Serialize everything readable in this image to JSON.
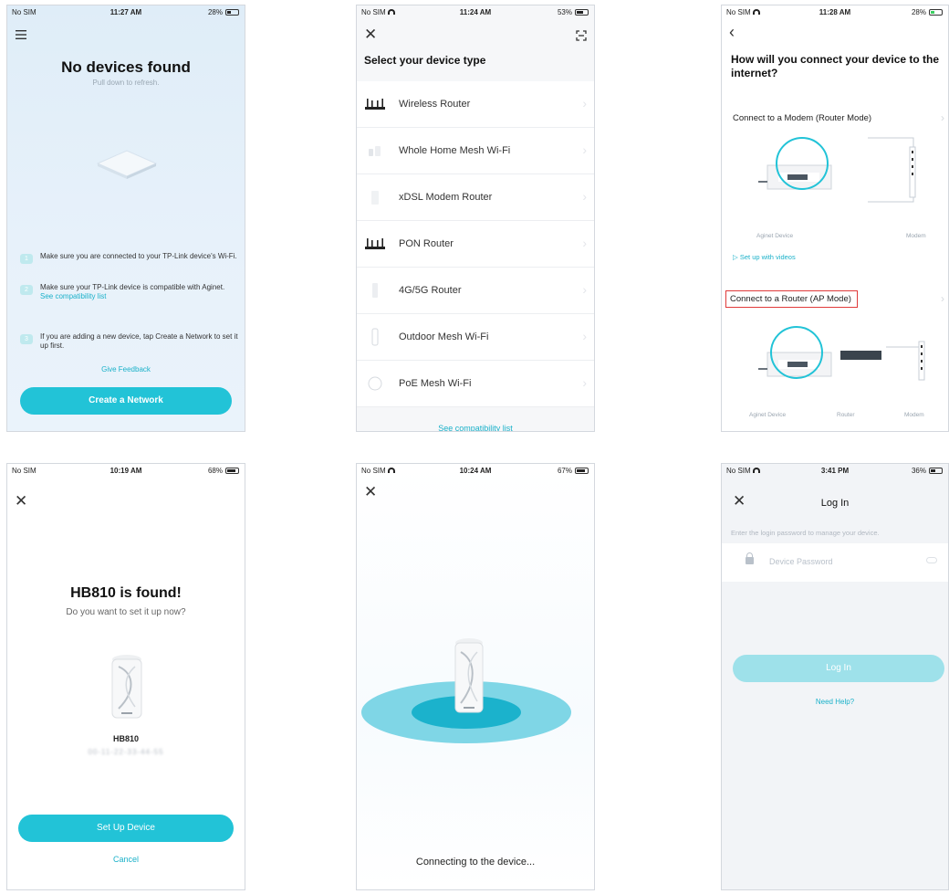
{
  "screens": {
    "no_devices": {
      "status": {
        "carrier": "No SIM",
        "time": "11:27 AM",
        "battery": "28%"
      },
      "menu_icon": "hamburger-menu-icon",
      "title": "No devices found",
      "subtitle": "Pull down to refresh.",
      "tips": [
        {
          "num": "1",
          "text": "Make sure you are connected to your TP-Link device's Wi-Fi.",
          "link": ""
        },
        {
          "num": "2",
          "text": "Make sure your TP-Link device is compatible with Aginet.",
          "link": "See compatibility list"
        },
        {
          "num": "3",
          "text": "If you are adding a new device, tap Create a Network to set it up first.",
          "link": ""
        }
      ],
      "feedback": "Give Feedback",
      "cta": "Create a Network"
    },
    "device_type": {
      "status": {
        "carrier": "No SIM",
        "time": "11:24 AM",
        "battery": "53%"
      },
      "title": "Select your device type",
      "devices": [
        {
          "label": "Wireless Router",
          "icon": "wireless-router-icon"
        },
        {
          "label": "Whole Home Mesh Wi-Fi",
          "icon": "mesh-wifi-icon"
        },
        {
          "label": "xDSL Modem Router",
          "icon": "xdsl-modem-icon"
        },
        {
          "label": "PON Router",
          "icon": "pon-router-icon"
        },
        {
          "label": "4G/5G Router",
          "icon": "cellular-router-icon"
        },
        {
          "label": "Outdoor Mesh Wi-Fi",
          "icon": "outdoor-mesh-icon"
        },
        {
          "label": "PoE Mesh Wi-Fi",
          "icon": "poe-mesh-icon"
        }
      ],
      "compat_link": "See compatibility list"
    },
    "connect_mode": {
      "status": {
        "carrier": "No SIM",
        "time": "11:28 AM",
        "battery": "28%"
      },
      "title": "How will you connect your device to the internet?",
      "option_router": {
        "title": "Connect to a Modem (Router Mode)",
        "labels": [
          "Aginet Device",
          "Modem"
        ]
      },
      "video_link": "Set up with videos",
      "option_ap": {
        "title": "Connect to a Router (AP Mode)",
        "labels": [
          "Aginet Device",
          "Router",
          "Modem"
        ]
      },
      "highlight_color": "#e03a3a"
    },
    "found": {
      "status": {
        "carrier": "No SIM",
        "time": "10:19 AM",
        "battery": "68%"
      },
      "title": "HB810 is found!",
      "subtitle": "Do you want to set it up now?",
      "device_name": "HB810",
      "mac": "00-11-22-33-44-55",
      "primary": "Set Up Device",
      "cancel": "Cancel"
    },
    "connecting": {
      "status": {
        "carrier": "No SIM",
        "time": "10:24 AM",
        "battery": "67%"
      },
      "message": "Connecting to the device..."
    },
    "login": {
      "status": {
        "carrier": "No SIM",
        "time": "3:41 PM",
        "battery": "36%"
      },
      "title": "Log In",
      "hint": "Enter the login password to manage your device.",
      "password_placeholder": "Device Password",
      "button": "Log In",
      "help": "Need Help?"
    }
  },
  "colors": {
    "accent": "#22c3d7",
    "link": "#1ab1c9",
    "disabled_button": "#9ee1ea"
  }
}
